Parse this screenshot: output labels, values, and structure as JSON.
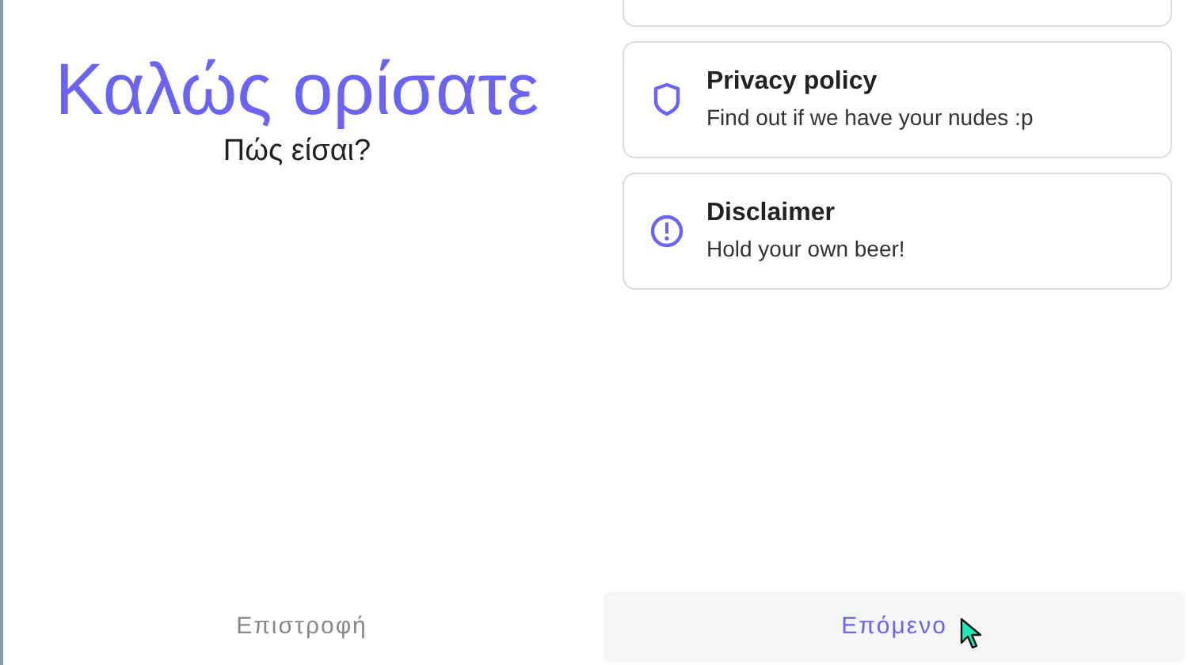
{
  "welcome": {
    "title": "Καλώς ορίσατε",
    "subtitle": "Πώς είσαι?"
  },
  "cards": [
    {
      "kind": "cut"
    },
    {
      "kind": "shield",
      "title": "Privacy policy",
      "description": "Find out if we have your nudes :p"
    },
    {
      "kind": "alert",
      "title": "Disclaimer",
      "description": "Hold your own beer!"
    }
  ],
  "buttons": [
    {
      "label": "Επιστροφή",
      "primary": false
    },
    {
      "label": "Επόμενο",
      "primary": true
    }
  ]
}
